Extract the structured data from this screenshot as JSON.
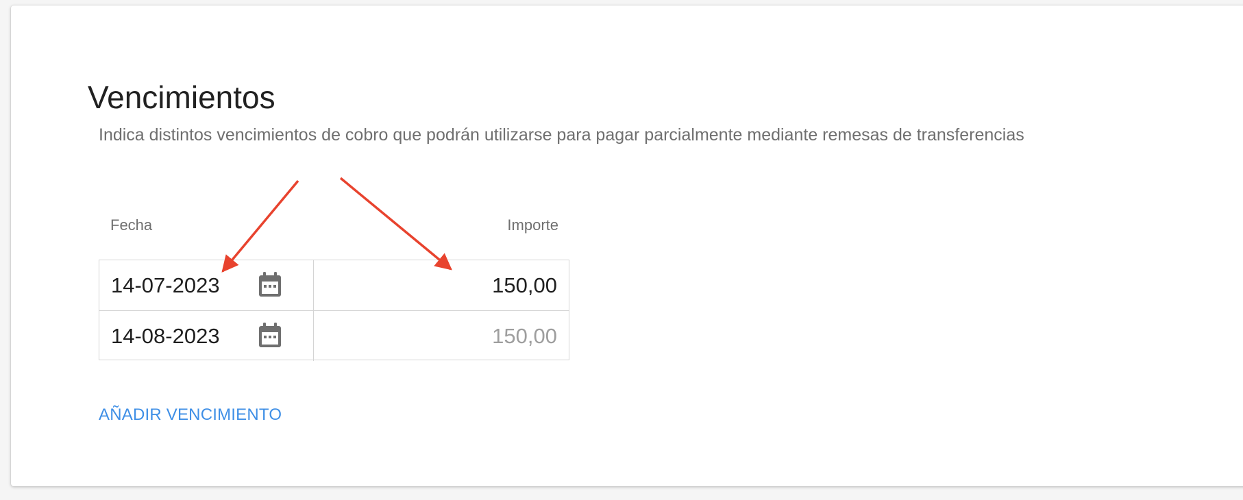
{
  "section": {
    "title": "Vencimientos",
    "description": "Indica distintos vencimientos de cobro que podrán utilizarse para pagar parcialmente mediante remesas de transferencias"
  },
  "table": {
    "headers": {
      "date": "Fecha",
      "amount": "Importe"
    },
    "rows": [
      {
        "date": "14-07-2023",
        "amount": "150,00",
        "amount_state": "entered"
      },
      {
        "date": "14-08-2023",
        "amount": "150,00",
        "amount_state": "placeholder"
      }
    ],
    "icon": "calendar-icon"
  },
  "actions": {
    "add_label": "AÑADIR VENCIMIENTO"
  },
  "colors": {
    "accent": "#3f8fe6",
    "annotation": "#e8432e",
    "text": "#1f1f1f",
    "muted": "#9e9e9e"
  }
}
